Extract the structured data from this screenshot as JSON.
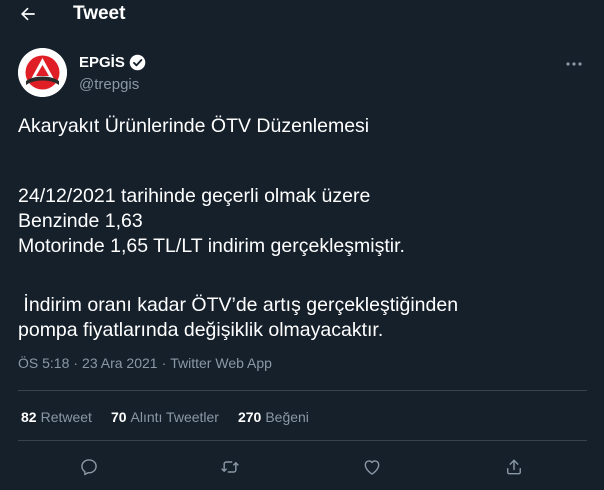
{
  "header": {
    "title": "Tweet"
  },
  "author": {
    "display_name": "EPGİS",
    "handle": "@trepgis"
  },
  "tweet": {
    "lines": [
      "Akaryakıt Ürünlerinde ÖTV Düzenlemesi",
      "24/12/2021 tarihinde geçerli olmak üzere",
      "Benzinde 1,63",
      "Motorinde 1,65 TL/LT indirim gerçekleşmiştir.",
      " İndirim oranı kadar ÖTV’de artış gerçekleştiğinden",
      "pompa fiyatlarında değişiklik olmayacaktır."
    ],
    "time": "ÖS 5:18",
    "date": "23 Ara 2021",
    "separator": "·",
    "source": "Twitter Web App"
  },
  "stats": {
    "retweets": {
      "count": "82",
      "label": "Retweet"
    },
    "quotes": {
      "count": "70",
      "label": "Alıntı Tweetler"
    },
    "likes": {
      "count": "270",
      "label": "Beğeni"
    }
  },
  "colors": {
    "background": "#15202b",
    "text": "#ffffff",
    "secondary": "#8b98a5",
    "divider": "#38444d",
    "logo_red": "#e01e26"
  },
  "icons": {
    "back": "arrow-left-icon",
    "verified": "verified-badge-icon",
    "more": "more-horizontal-icon",
    "reply": "reply-icon",
    "retweet": "retweet-icon",
    "like": "heart-icon",
    "share": "share-icon"
  }
}
